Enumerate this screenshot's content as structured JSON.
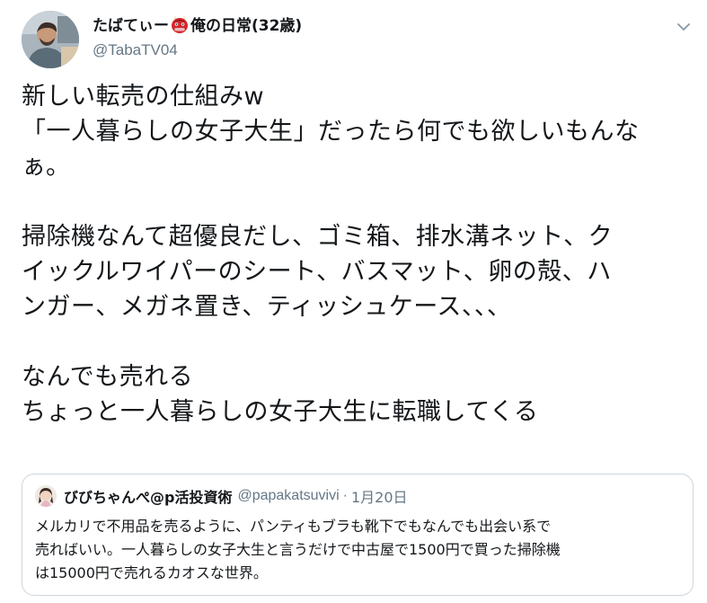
{
  "tweet": {
    "author": {
      "name_prefix": "たばてぃー",
      "name_suffix": "俺の日常(32歳)",
      "handle": "@TabaTV04",
      "name_emoji": "ogre-emoji"
    },
    "text": "新しい転売の仕組みw\n「一人暮らしの女子大生」だったら何でも欲しいもんな\nぁ。\n\n掃除機なんて超優良だし、ゴミ箱、排水溝ネット、ク\nイックルワイパーのシート、バスマット、卵の殻、ハ\nンガー、メガネ置き、ティッシュケース、、、\n\nなんでも売れる\nちょっと一人暮らしの女子大生に転職してくる",
    "menu_icon": "chevron-down-icon"
  },
  "quoted_tweet": {
    "name": "びびちゃんぺ@p活投資術",
    "handle": "@papakatsuvivi",
    "separator": "·",
    "date": "1月20日",
    "text": "メルカリで不用品を売るように、パンティもブラも靴下でもなんでも出会い系で\n売ればいい。一人暮らしの女子大生と言うだけで中古屋で1500円で買った掃除機\nは15000円で売れるカオスな世界。"
  },
  "colors": {
    "primary_text": "#14171a",
    "secondary_text": "#657786",
    "border": "#ccd6dd",
    "emoji_red": "#d6262b"
  }
}
